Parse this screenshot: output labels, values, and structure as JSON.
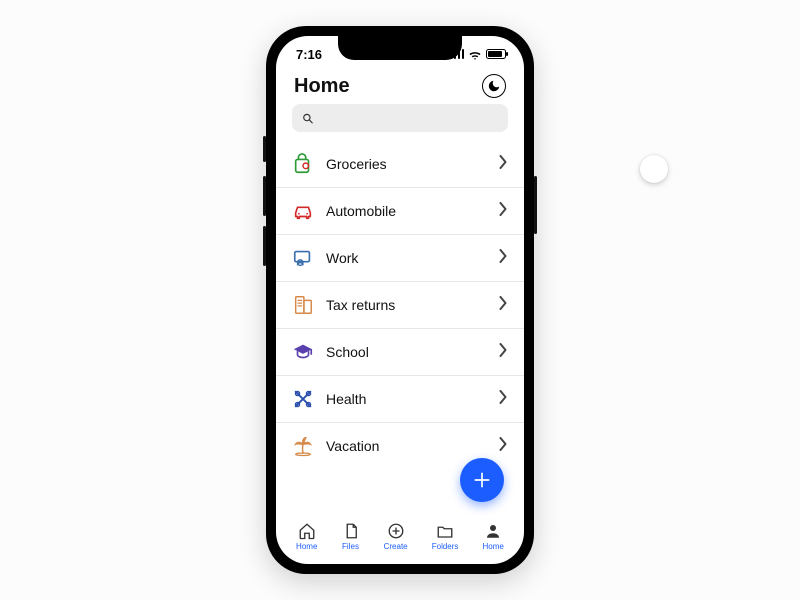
{
  "status": {
    "time": "7:16"
  },
  "header": {
    "title": "Home"
  },
  "search": {
    "placeholder": ""
  },
  "categories": [
    {
      "id": "groceries",
      "label": "Groceries",
      "color": "#2e9a3a"
    },
    {
      "id": "automobile",
      "label": "Automobile",
      "color": "#d22a2a"
    },
    {
      "id": "work",
      "label": "Work",
      "color": "#3a6fae"
    },
    {
      "id": "tax",
      "label": "Tax returns",
      "color": "#d68a4a"
    },
    {
      "id": "school",
      "label": "School",
      "color": "#5a3fae"
    },
    {
      "id": "health",
      "label": "Health",
      "color": "#2a4fae"
    },
    {
      "id": "vacation",
      "label": "Vacation",
      "color": "#d68a4a"
    }
  ],
  "nav": [
    {
      "id": "home",
      "label": "Home"
    },
    {
      "id": "files",
      "label": "Files"
    },
    {
      "id": "create",
      "label": "Create"
    },
    {
      "id": "folders",
      "label": "Folders"
    },
    {
      "id": "profile",
      "label": "Home"
    }
  ]
}
